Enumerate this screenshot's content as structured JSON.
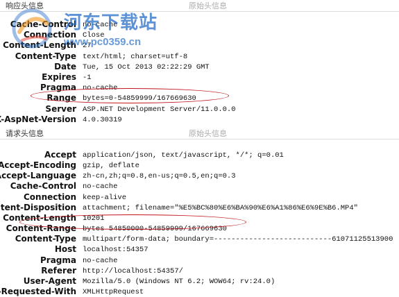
{
  "response": {
    "title": "响应头信息",
    "raw_label": "原始头信息",
    "rows": [
      {
        "key": "Cache-Control",
        "value": "no-cache"
      },
      {
        "key": "Connection",
        "value": "Close"
      },
      {
        "key": "Content-Length",
        "value": "27"
      },
      {
        "key": "Content-Type",
        "value": "text/html; charset=utf-8"
      },
      {
        "key": "Date",
        "value": "Tue, 15 Oct 2013 02:22:29 GMT"
      },
      {
        "key": "Expires",
        "value": "-1"
      },
      {
        "key": "Pragma",
        "value": "no-cache"
      },
      {
        "key": "Range",
        "value": "bytes=0-54859999/167669630"
      },
      {
        "key": "Server",
        "value": "ASP.NET Development Server/11.0.0.0"
      },
      {
        "key": "X-AspNet-Version",
        "value": "4.0.30319"
      }
    ]
  },
  "request": {
    "title": "请求头信息",
    "raw_label": "原始头信息",
    "rows": [
      {
        "key": "Accept",
        "value": "application/json, text/javascript, */*; q=0.01"
      },
      {
        "key": "Accept-Encoding",
        "value": "gzip, deflate"
      },
      {
        "key": "Accept-Language",
        "value": "zh-cn,zh;q=0.8,en-us;q=0.5,en;q=0.3"
      },
      {
        "key": "Cache-Control",
        "value": "no-cache"
      },
      {
        "key": "Connection",
        "value": "keep-alive"
      },
      {
        "key": "Content-Disposition",
        "value": "attachment; filename=\"%E5%BC%80%E6%BA%90%E6%A1%86%E6%9E%B6.MP4\""
      },
      {
        "key": "Content-Length",
        "value": "10201"
      },
      {
        "key": "Content-Range",
        "value": "bytes 54850000-54859999/167669630"
      },
      {
        "key": "Content-Type",
        "value": "multipart/form-data; boundary=---------------------------61071125513900"
      },
      {
        "key": "Host",
        "value": "localhost:54357"
      },
      {
        "key": "Pragma",
        "value": "no-cache"
      },
      {
        "key": "Referer",
        "value": "http://localhost:54357/"
      },
      {
        "key": "User-Agent",
        "value": "Mozilla/5.0 (Windows NT 6.2; WOW64; rv:24.0)"
      },
      {
        "key": "X-Requested-With",
        "value": "XMLHttpRequest"
      }
    ]
  },
  "watermark": {
    "brand": "河东下载站",
    "url": "www.pc0359.cn"
  },
  "colors": {
    "highlight_oval": "#c0141c",
    "watermark": "#286ec8"
  }
}
